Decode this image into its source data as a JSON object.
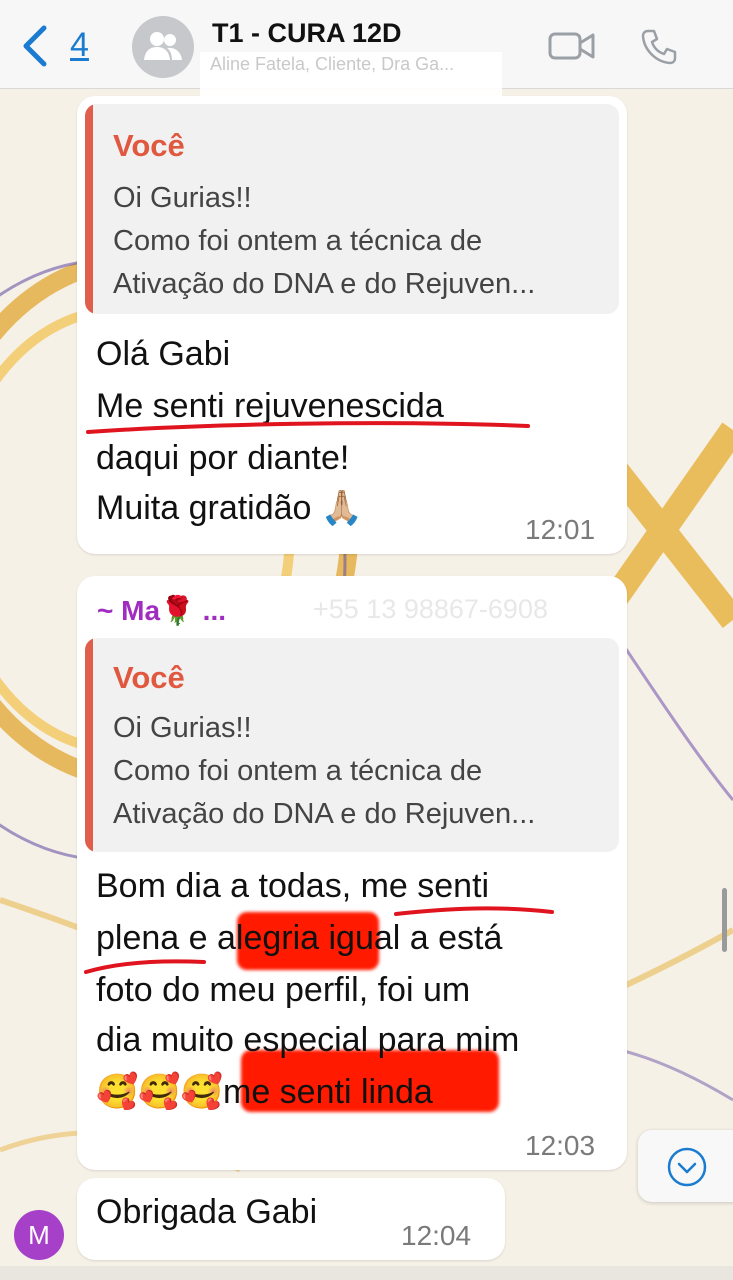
{
  "header": {
    "back_count": "4",
    "title": "T1 - CURA 12D",
    "subtitle": "Aline Fatela, Cliente, Dra Ga..."
  },
  "messages": [
    {
      "quote": {
        "author": "Você",
        "lines": [
          "Oi Gurias!!",
          "Como foi ontem a técnica de",
          "Ativação do DNA e do Rejuven..."
        ]
      },
      "lines": [
        "Olá Gabi",
        "Me senti rejuvenescida",
        "daqui por diante!",
        "Muita gratidão 🙏🏼"
      ],
      "time": "12:01"
    },
    {
      "sender": "~ Ma🌹 ...",
      "sender_phone": "+55 13 98867-6908",
      "quote": {
        "author": "Você",
        "lines": [
          "Oi Gurias!!",
          "Como foi ontem a técnica de",
          "Ativação do DNA e do Rejuven..."
        ]
      },
      "lines": [
        "Bom dia a todas, me senti",
        "plena e alegria igual a está",
        "foto do meu perfil, foi um",
        "dia muito especial para mim",
        "🥰🥰🥰me senti linda"
      ],
      "time": "12:03"
    },
    {
      "avatar_letter": "M",
      "lines": [
        "Obrigada Gabi"
      ],
      "time": "12:04"
    }
  ],
  "colors": {
    "accent": "#1a7bd0",
    "quote_bar": "#e15e4c",
    "sender": "#a12cc0",
    "highlight": "#ff1a00",
    "underline": "#e0141e"
  },
  "icons": [
    "back-chevron-icon",
    "group-avatar-icon",
    "video-call-icon",
    "phone-call-icon",
    "chevron-down-icon"
  ]
}
